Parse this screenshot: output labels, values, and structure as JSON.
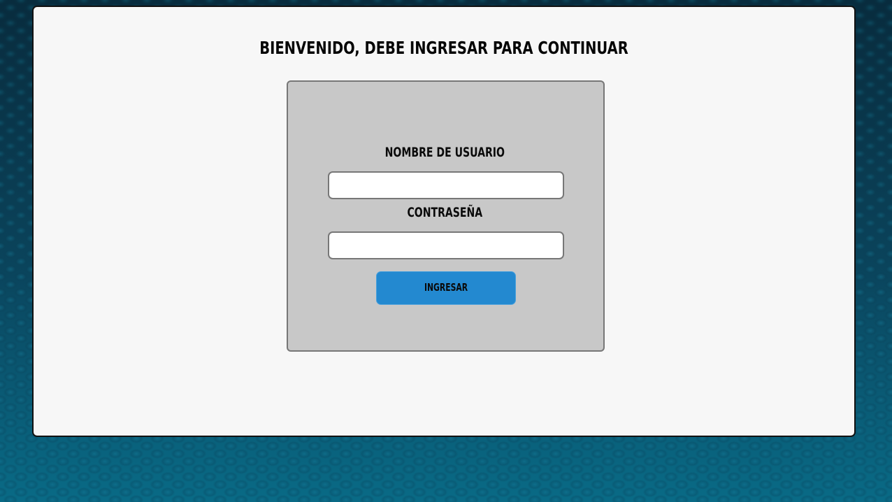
{
  "page": {
    "heading": "BIENVENIDO, DEBE INGRESAR PARA CONTINUAR"
  },
  "login_form": {
    "username_label": "NOMBRE DE USUARIO",
    "username_value": "",
    "password_label": "CONTRASEÑA",
    "password_value": "",
    "submit_label": "INGRESAR"
  },
  "colors": {
    "panel_background": "#f7f7f7",
    "form_background": "#c8c8c8",
    "button_background": "#2389d0",
    "page_background": "#0b4560"
  }
}
